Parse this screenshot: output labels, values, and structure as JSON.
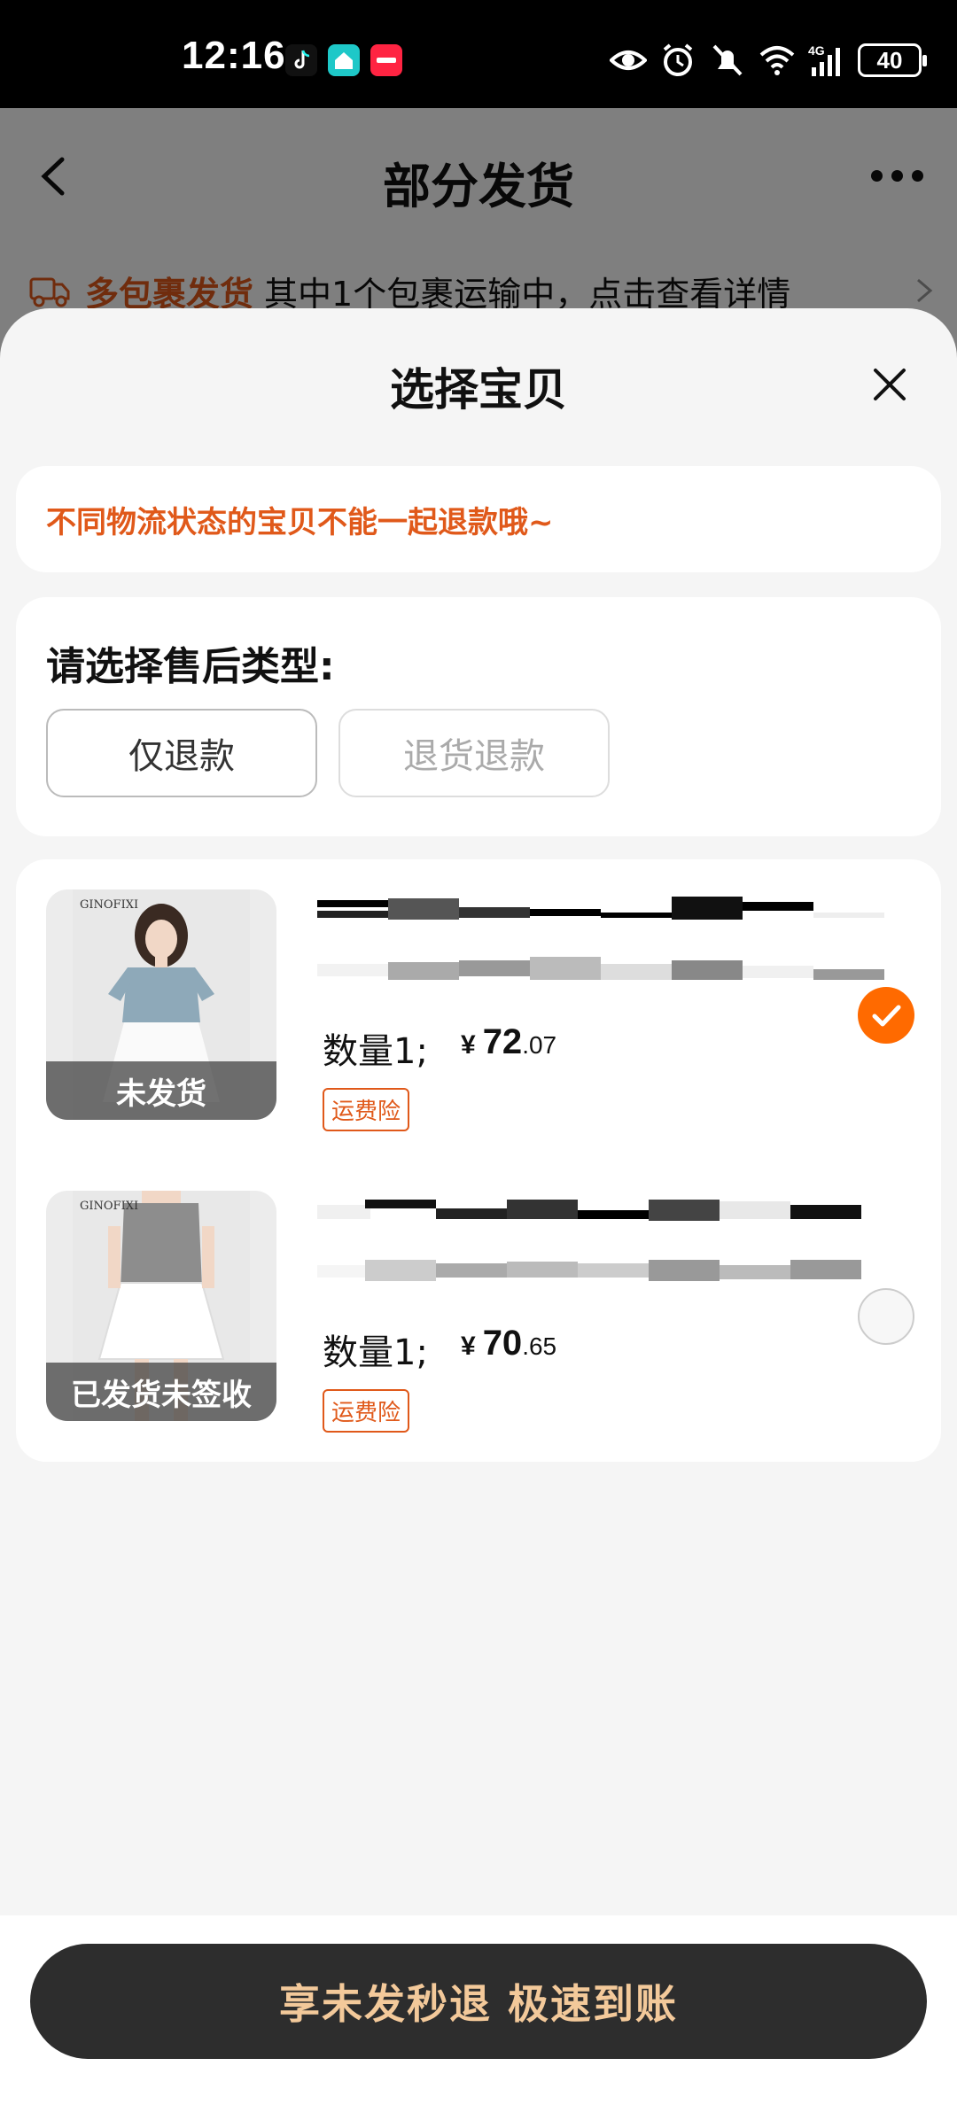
{
  "status_bar": {
    "time": "12:16",
    "battery": "40",
    "icons": [
      "tiktok-icon",
      "app-icon",
      "xiaohongshu-icon",
      "eye-icon",
      "alarm-icon",
      "mute-icon",
      "wifi-icon",
      "signal-4g-icon"
    ]
  },
  "background_page": {
    "title": "部分发货",
    "notice_highlight": "多包裹发货",
    "notice_text": "其中1个包裹运输中，点击查看详情"
  },
  "sheet": {
    "title": "选择宝贝",
    "warning": "不同物流状态的宝贝不能一起退款哦~",
    "type_label": "请选择售后类型:",
    "options": [
      {
        "label": "仅退款",
        "enabled": true
      },
      {
        "label": "退货退款",
        "enabled": false
      }
    ],
    "items": [
      {
        "status": "未发货",
        "brand": "GINOFIXI",
        "quantity": "数量1;",
        "currency": "¥",
        "price_int": "72",
        "price_dec": ".07",
        "tag": "运费险",
        "selected": true
      },
      {
        "status": "已发货未签收",
        "brand": "GINOFIXI",
        "quantity": "数量1;",
        "currency": "¥",
        "price_int": "70",
        "price_dec": ".65",
        "tag": "运费险",
        "selected": false
      }
    ]
  },
  "bottom": {
    "cta": "享未发秒退 极速到账"
  },
  "colors": {
    "accent": "#ff6a00",
    "warning_text": "#e0591a",
    "cta_bg": "#2d2d2d",
    "cta_text": "#f3c99a"
  }
}
